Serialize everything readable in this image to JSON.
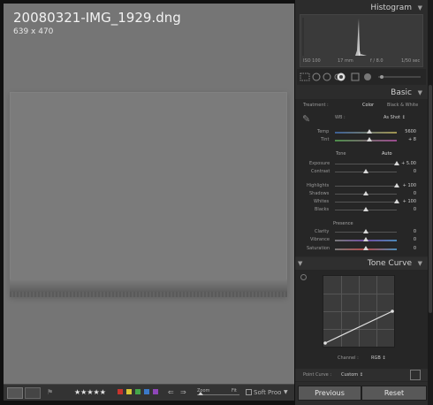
{
  "image": {
    "file_name": "20080321-IMG_1929.dng",
    "dimensions": "639 x 470"
  },
  "histogram": {
    "title": "Histogram",
    "readouts": [
      "ISO 100",
      "17 mm",
      "f / 8.0",
      "1/50 sec"
    ]
  },
  "basic": {
    "title": "Basic",
    "treatment_label": "Treatment :",
    "treatment_color": "Color",
    "treatment_bw": "Black & White",
    "wb_label": "WB :",
    "wb_value": "As Shot ↕",
    "temp": {
      "label": "Temp",
      "value": "5600",
      "level": 0.55
    },
    "tint": {
      "label": "Tint",
      "value": "+ 8",
      "level": 0.56
    },
    "tone_label": "Tone",
    "tone_auto": "Auto",
    "exposure": {
      "label": "Exposure",
      "value": "+ 5.00",
      "level": 1.0
    },
    "contrast": {
      "label": "Contrast",
      "value": "0",
      "level": 0.5
    },
    "highlights": {
      "label": "Highlights",
      "value": "+ 100",
      "level": 1.0
    },
    "shadows": {
      "label": "Shadows",
      "value": "0",
      "level": 0.5
    },
    "whites": {
      "label": "Whites",
      "value": "+ 100",
      "level": 1.0
    },
    "blacks": {
      "label": "Blacks",
      "value": "0",
      "level": 0.5
    },
    "presence_label": "Presence",
    "clarity": {
      "label": "Clarity",
      "value": "0",
      "level": 0.5
    },
    "vibrance": {
      "label": "Vibrance",
      "value": "0",
      "level": 0.5
    },
    "saturation": {
      "label": "Saturation",
      "value": "0",
      "level": 0.5
    }
  },
  "tone_curve": {
    "title": "Tone Curve",
    "channel_label": "Channel :",
    "channel_value": "RGB ↕",
    "point_curve_label": "Point Curve :",
    "point_curve_value": "Custom ↕"
  },
  "buttons": {
    "previous": "Previous",
    "reset": "Reset"
  },
  "toolbar": {
    "stars": "★★★★★",
    "zoom_label": "Zoom",
    "fit_label": "Fit",
    "soft_proof": "Soft Proo",
    "label_colors": [
      "#c8342c",
      "#d8c636",
      "#44a64a",
      "#3b79c9",
      "#8f46b8"
    ]
  },
  "colors": {
    "canvas": "#757575",
    "panel": "#2c2c2c"
  }
}
